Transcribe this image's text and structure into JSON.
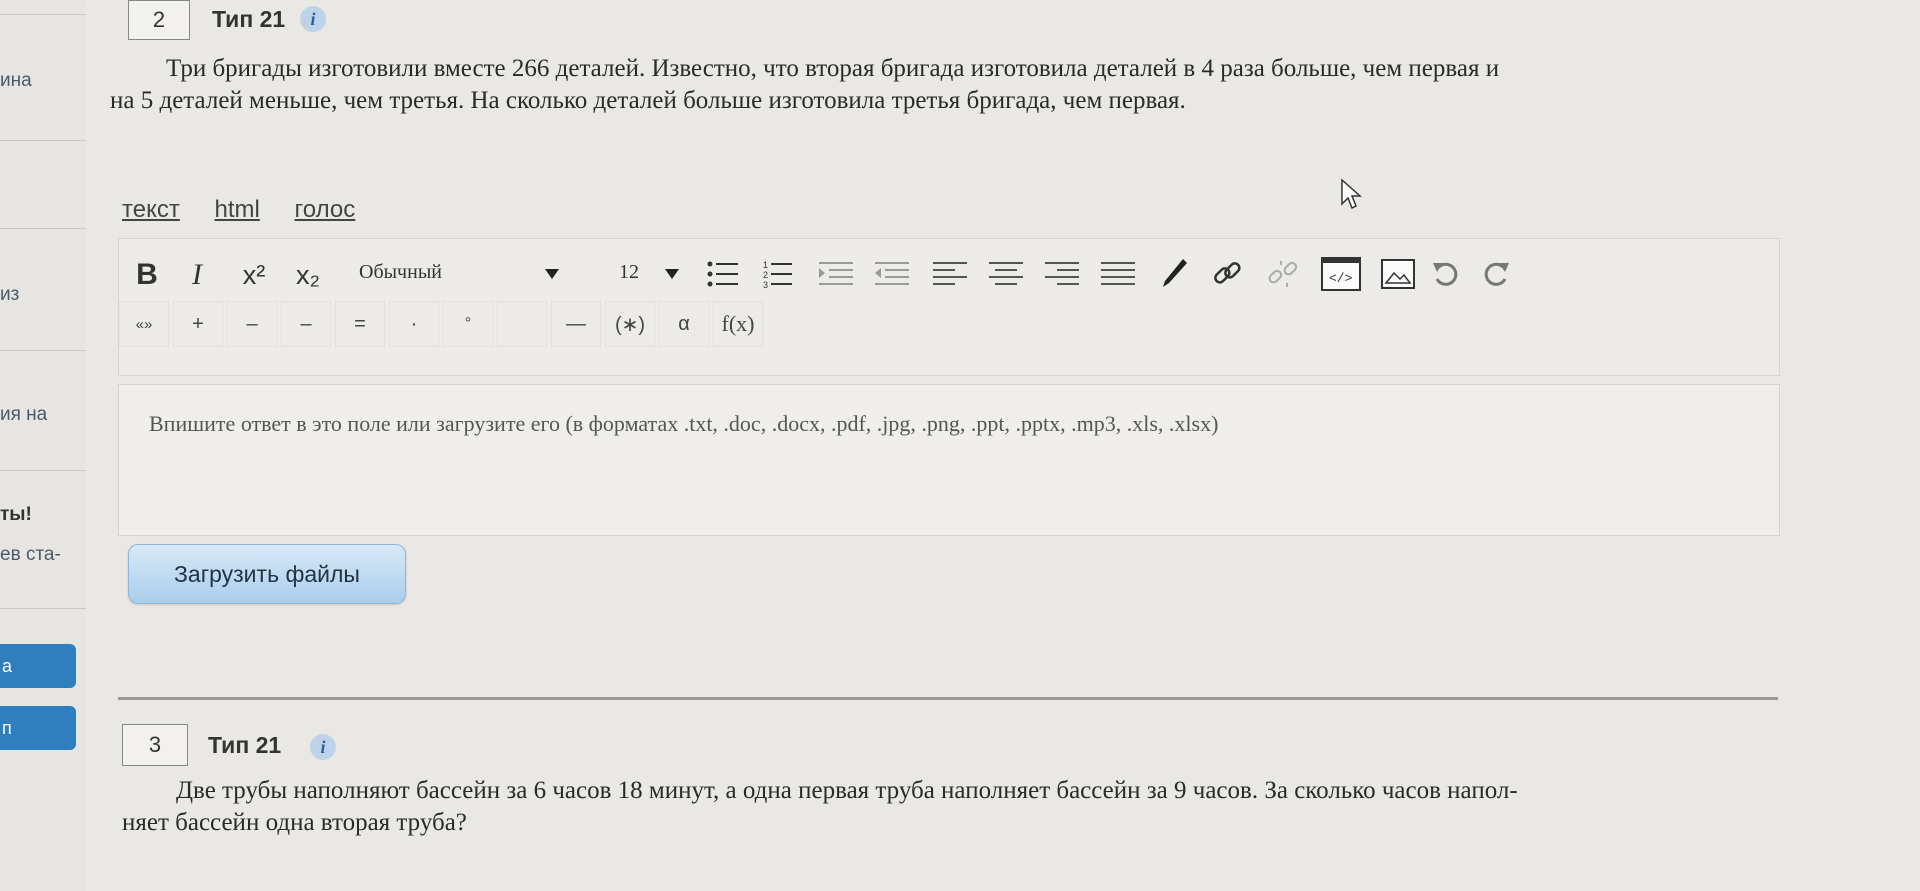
{
  "sidebar": {
    "fragments": [
      "ина",
      "из",
      "ия на",
      "ты!",
      "ев ста-",
      "а",
      "п"
    ]
  },
  "question2": {
    "number": "2",
    "type": "Тип 21",
    "info": "i",
    "text_line1": "Три бригады изготовили вместе 266 деталей. Известно, что вторая бригада изготовила деталей в 4 раза больше, чем первая и",
    "text_line2": "на 5 деталей меньше, чем третья. На сколько деталей больше изготовила третья бригада, чем первая."
  },
  "editor": {
    "modes": [
      "текст",
      "html",
      "голос"
    ],
    "toolbar": {
      "bold": "B",
      "italic": "I",
      "superscript": "x²",
      "subscript": "x₂",
      "format": "Обычный",
      "size": "12"
    },
    "symbols": [
      "«»",
      "+",
      "–",
      "–",
      "=",
      "·",
      "°",
      "",
      "—",
      "(∗)",
      "α",
      "f(x)"
    ]
  },
  "answer": {
    "placeholder": "Впишите ответ в это поле или загрузите его (в форматах .txt, .doc, .docx, .pdf, .jpg, .png, .ppt, .pptx, .mp3, .xls, .xlsx)"
  },
  "upload_button": "Загрузить файлы",
  "question3": {
    "number": "3",
    "type": "Тип 21",
    "info": "i",
    "text_line1": "Две трубы наполняют бассейн за 6 часов 18 минут, а одна первая труба наполняет бассейн за 9 часов. За сколько часов напол-",
    "text_line2": "няет бассейн одна вторая труба?"
  }
}
